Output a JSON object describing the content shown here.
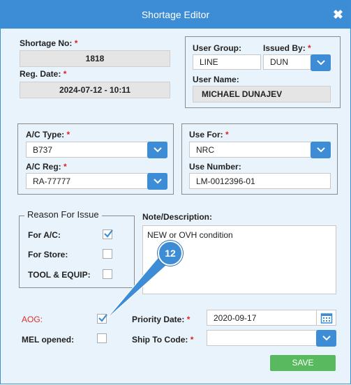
{
  "window": {
    "title": "Shortage Editor",
    "close_glyph": "✖"
  },
  "shortage": {
    "no_label": "Shortage No:",
    "no_value": "1818",
    "reg_label": "Reg. Date:",
    "reg_value": "2024-07-12 - 10:11"
  },
  "user": {
    "group_label": "User Group:",
    "group_value": "LINE",
    "issued_label": "Issued By:",
    "issued_value": "DUN",
    "name_label": "User Name:",
    "name_value": "MICHAEL DUNAJEV"
  },
  "aircraft": {
    "type_label": "A/C Type:",
    "type_value": "B737",
    "reg_label": "A/C Reg:",
    "reg_value": "RA-77777"
  },
  "use": {
    "for_label": "Use For:",
    "for_value": "NRC",
    "number_label": "Use Number:",
    "number_value": "LM-0012396-01"
  },
  "reason": {
    "legend": "Reason For Issue",
    "items": [
      {
        "label": "For A/C:",
        "checked": true
      },
      {
        "label": "For Store:",
        "checked": false
      },
      {
        "label": "TOOL & EQUIP:",
        "checked": false
      }
    ]
  },
  "note": {
    "label": "Note/Description:",
    "value": "NEW or OVH condition"
  },
  "aog": {
    "label": "AOG:",
    "checked": true
  },
  "mel": {
    "label": "MEL opened:",
    "checked": false
  },
  "priority": {
    "label": "Priority Date:",
    "value": "2020-09-17"
  },
  "ship": {
    "label": "Ship To Code:",
    "value": ""
  },
  "save_label": "SAVE",
  "annotation": {
    "badge": "12"
  },
  "colors": {
    "accent": "#3c8dd6",
    "save": "#58b95e",
    "required": "#e02020",
    "aog_label": "#d9302c"
  },
  "required_mark": "*"
}
